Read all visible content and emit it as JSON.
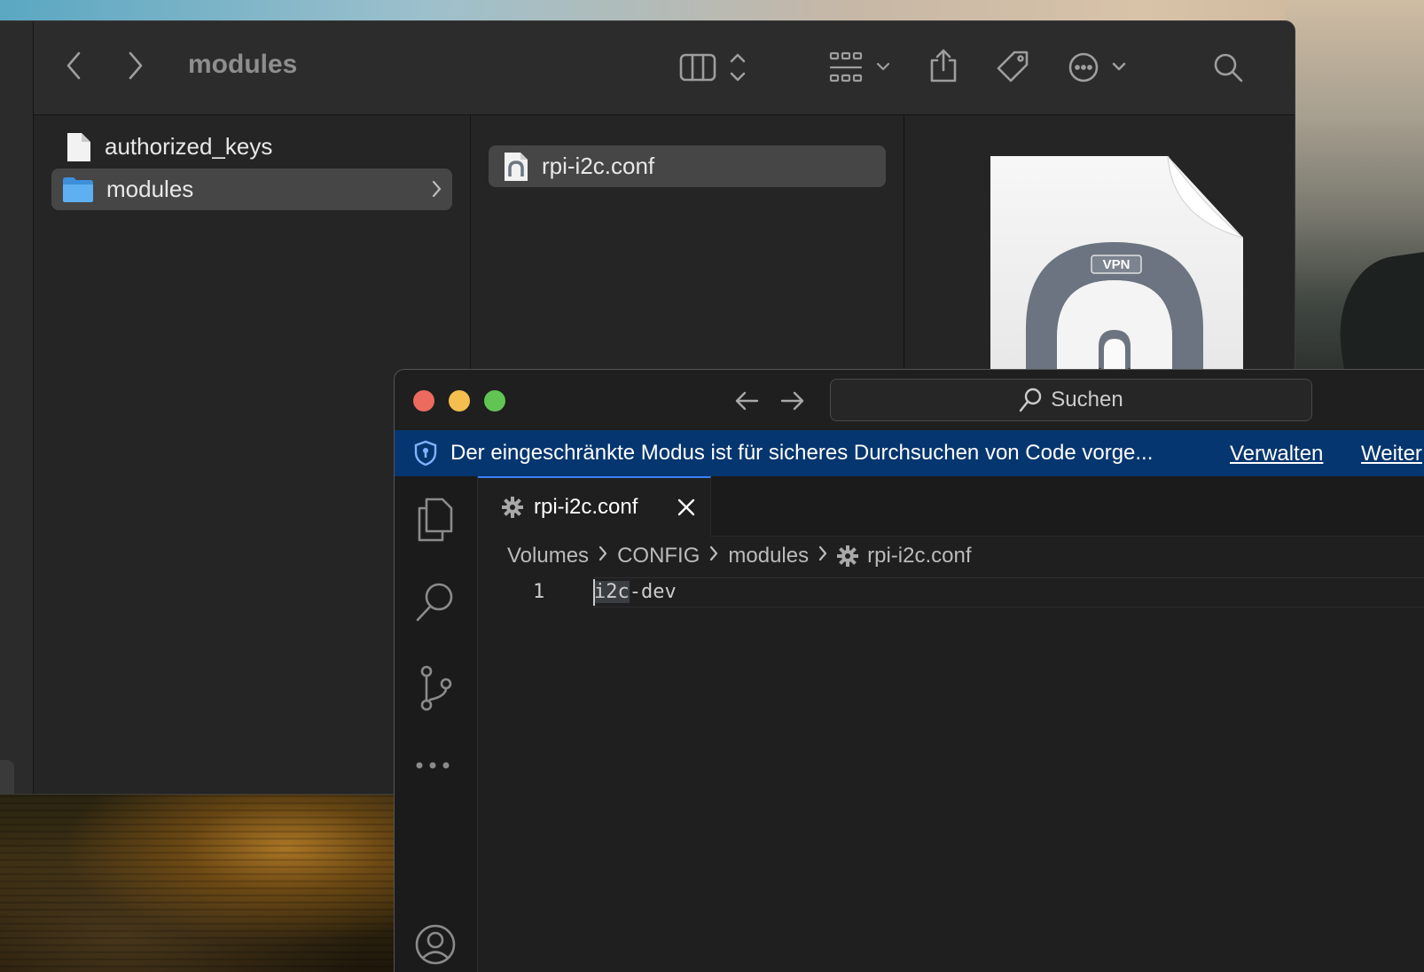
{
  "finder": {
    "title": "modules",
    "toolbar": {
      "icons": [
        "back-icon",
        "forward-icon",
        "column-view-icon",
        "group-grid-icon",
        "share-icon",
        "tag-icon",
        "more-icon",
        "search-icon"
      ]
    },
    "column1": {
      "items": [
        {
          "label": "authorized_keys",
          "icon": "document-icon",
          "selected": false
        },
        {
          "label": "modules",
          "icon": "folder-icon",
          "selected": true
        }
      ]
    },
    "column2": {
      "items": [
        {
          "label": "rpi-i2c.conf",
          "icon": "vpn-config-icon",
          "selected": true
        }
      ]
    },
    "preview": {
      "badge": "VPN"
    }
  },
  "vscode": {
    "search_label": "Suchen",
    "banner": {
      "message": "Der eingeschränkte Modus ist für sicheres Durchsuchen von Code vorge...",
      "manage_link": "Verwalten",
      "more_link": "Weiter"
    },
    "tab": {
      "label": "rpi-i2c.conf"
    },
    "breadcrumb": [
      "Volumes",
      "CONFIG",
      "modules",
      "rpi-i2c.conf"
    ],
    "editor": {
      "lines": [
        {
          "number": "1",
          "selected_text": "i2c",
          "rest_text": "-dev"
        }
      ]
    },
    "colors": {
      "banner_bg": "#06366f",
      "tab_accent": "#3b82f6",
      "editor_bg": "#1f1f1f"
    }
  }
}
